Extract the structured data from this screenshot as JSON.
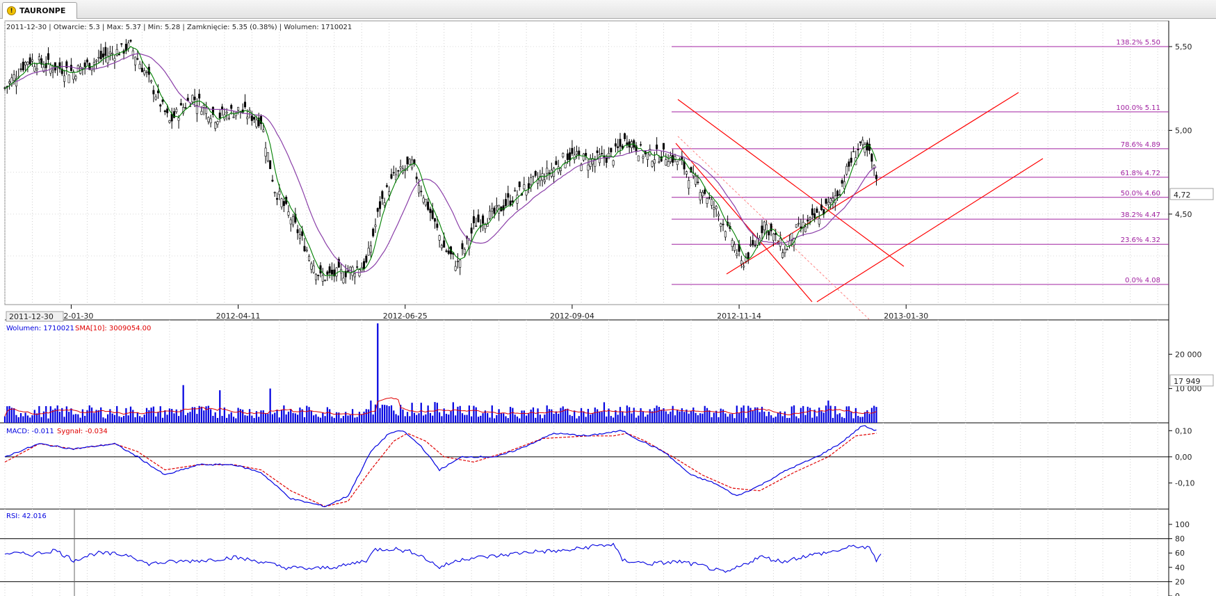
{
  "tab": {
    "title": "TAURONPE",
    "icon": "warning-icon"
  },
  "info": {
    "price": "2011-12-30 | Otwarcie: 5.3 | Max: 5.37 | Min: 5.28 | Zamknięcie: 5.35 (0.38%) | Wolumen: 1710021",
    "volume": "Wolumen: 1710021",
    "volume_sma": "SMA[10]: 3009054.00",
    "macd": "MACD: -0.011",
    "signal": "Sygnał: -0.034",
    "rsi": "RSI: 42.016"
  },
  "cursor": {
    "date": "2011-12-30",
    "price": "4,72",
    "volume": "17 949"
  },
  "colors": {
    "candle": "#000000",
    "sma_fast": "#008000",
    "sma_slow": "#8a3ea8",
    "fib": "#a020a0",
    "trend": "#ff0000",
    "volume": "#0000e0",
    "volume_sma": "#e00000",
    "macd": "#0000e0",
    "signal": "#e00000",
    "rsi": "#0000e0"
  },
  "chart_data": [
    {
      "type": "candlestick",
      "x_ticks": [
        "2012-01-30",
        "2012-04-11",
        "2012-06-25",
        "2012-09-04",
        "2012-11-14",
        "2013-01-30"
      ],
      "y_ticks": [
        "5,50",
        "5,00",
        "4,50"
      ],
      "y_tick_values": [
        5.5,
        5.0,
        4.5
      ],
      "ylim": [
        4.0,
        5.9
      ],
      "close_anchors": [
        [
          0,
          5.25
        ],
        [
          10,
          5.42
        ],
        [
          30,
          5.35
        ],
        [
          45,
          5.45
        ],
        [
          55,
          5.5
        ],
        [
          62,
          5.33
        ],
        [
          72,
          5.05
        ],
        [
          82,
          5.2
        ],
        [
          92,
          5.08
        ],
        [
          102,
          5.12
        ],
        [
          112,
          5.06
        ],
        [
          118,
          4.65
        ],
        [
          128,
          4.4
        ],
        [
          138,
          4.12
        ],
        [
          148,
          4.15
        ],
        [
          158,
          4.2
        ],
        [
          164,
          4.55
        ],
        [
          170,
          4.72
        ],
        [
          178,
          4.8
        ],
        [
          184,
          4.58
        ],
        [
          192,
          4.3
        ],
        [
          198,
          4.2
        ],
        [
          206,
          4.45
        ],
        [
          214,
          4.5
        ],
        [
          222,
          4.6
        ],
        [
          230,
          4.68
        ],
        [
          238,
          4.75
        ],
        [
          246,
          4.85
        ],
        [
          256,
          4.82
        ],
        [
          266,
          4.85
        ],
        [
          272,
          4.95
        ],
        [
          280,
          4.85
        ],
        [
          290,
          4.85
        ],
        [
          296,
          4.8
        ],
        [
          300,
          4.72
        ],
        [
          305,
          4.65
        ],
        [
          312,
          4.5
        ],
        [
          318,
          4.35
        ],
        [
          322,
          4.2
        ],
        [
          328,
          4.32
        ],
        [
          332,
          4.45
        ],
        [
          337,
          4.35
        ],
        [
          341,
          4.28
        ],
        [
          346,
          4.4
        ],
        [
          352,
          4.45
        ],
        [
          360,
          4.55
        ],
        [
          365,
          4.65
        ],
        [
          370,
          4.82
        ],
        [
          374,
          4.92
        ],
        [
          378,
          4.85
        ],
        [
          381,
          4.72
        ]
      ],
      "sma_fast_label": "",
      "sma_slow_label": ""
    },
    {
      "type": "fibonacci",
      "levels": [
        {
          "label": "138.2% 5.50",
          "value": 5.5
        },
        {
          "label": "100.0% 5.11",
          "value": 5.11
        },
        {
          "label": "78.6% 4.89",
          "value": 4.89
        },
        {
          "label": "61.8% 4.72",
          "value": 4.72
        },
        {
          "label": "50.0% 4.60",
          "value": 4.6
        },
        {
          "label": "38.2% 4.47",
          "value": 4.47
        },
        {
          "label": "23.6% 4.32",
          "value": 4.32
        },
        {
          "label": "0.0% 4.08",
          "value": 4.08
        }
      ],
      "start_day": 274,
      "end_day": 415
    },
    {
      "type": "bar",
      "name": "volume",
      "y_ticks": [
        "20 000",
        "10 000"
      ],
      "y_tick_values": [
        20000,
        10000
      ],
      "ylim": [
        0,
        30000
      ],
      "spikes": [
        [
          78,
          11000
        ],
        [
          94,
          9500
        ],
        [
          116,
          10000
        ],
        [
          163,
          29000
        ],
        [
          160,
          6500
        ],
        [
          196,
          6000
        ],
        [
          262,
          6000
        ],
        [
          360,
          6500
        ]
      ],
      "base": 3200
    },
    {
      "type": "line",
      "name": "macd",
      "y_ticks": [
        "0,10",
        "0,00",
        "-0,10"
      ],
      "y_tick_values": [
        0.1,
        0.0,
        -0.1
      ],
      "ylim": [
        -0.2,
        0.13
      ],
      "macd_anchors": [
        [
          0,
          0.0
        ],
        [
          15,
          0.05
        ],
        [
          30,
          0.03
        ],
        [
          48,
          0.05
        ],
        [
          58,
          0.0
        ],
        [
          70,
          -0.07
        ],
        [
          85,
          -0.03
        ],
        [
          100,
          -0.03
        ],
        [
          112,
          -0.06
        ],
        [
          125,
          -0.16
        ],
        [
          140,
          -0.19
        ],
        [
          150,
          -0.15
        ],
        [
          160,
          0.02
        ],
        [
          168,
          0.09
        ],
        [
          174,
          0.1
        ],
        [
          182,
          0.04
        ],
        [
          190,
          -0.05
        ],
        [
          200,
          0.0
        ],
        [
          215,
          0.0
        ],
        [
          225,
          0.03
        ],
        [
          240,
          0.09
        ],
        [
          255,
          0.08
        ],
        [
          262,
          0.09
        ],
        [
          270,
          0.1
        ],
        [
          276,
          0.07
        ],
        [
          288,
          0.02
        ],
        [
          300,
          -0.07
        ],
        [
          310,
          -0.1
        ],
        [
          320,
          -0.15
        ],
        [
          330,
          -0.11
        ],
        [
          342,
          -0.05
        ],
        [
          355,
          0.0
        ],
        [
          365,
          0.05
        ],
        [
          375,
          0.12
        ],
        [
          381,
          0.1
        ]
      ],
      "signal_anchors": [
        [
          0,
          -0.02
        ],
        [
          15,
          0.05
        ],
        [
          30,
          0.03
        ],
        [
          48,
          0.05
        ],
        [
          58,
          0.02
        ],
        [
          70,
          -0.05
        ],
        [
          85,
          -0.03
        ],
        [
          100,
          -0.03
        ],
        [
          112,
          -0.05
        ],
        [
          125,
          -0.13
        ],
        [
          140,
          -0.19
        ],
        [
          150,
          -0.17
        ],
        [
          160,
          -0.05
        ],
        [
          170,
          0.06
        ],
        [
          176,
          0.09
        ],
        [
          184,
          0.06
        ],
        [
          192,
          0.0
        ],
        [
          205,
          -0.02
        ],
        [
          220,
          0.02
        ],
        [
          235,
          0.07
        ],
        [
          255,
          0.08
        ],
        [
          266,
          0.08
        ],
        [
          272,
          0.09
        ],
        [
          280,
          0.06
        ],
        [
          292,
          0.0
        ],
        [
          305,
          -0.07
        ],
        [
          318,
          -0.12
        ],
        [
          330,
          -0.13
        ],
        [
          345,
          -0.06
        ],
        [
          360,
          0.0
        ],
        [
          372,
          0.08
        ],
        [
          381,
          0.09
        ]
      ]
    },
    {
      "type": "line",
      "name": "rsi",
      "y_ticks": [
        "100",
        "80",
        "60",
        "40",
        "20",
        "0"
      ],
      "y_tick_values": [
        100,
        80,
        60,
        40,
        20,
        0
      ],
      "ylim": [
        0,
        100
      ],
      "guide_levels": [
        80,
        20
      ],
      "rsi_anchors": [
        [
          0,
          60
        ],
        [
          12,
          58
        ],
        [
          22,
          64
        ],
        [
          30,
          50
        ],
        [
          40,
          60
        ],
        [
          55,
          57
        ],
        [
          62,
          45
        ],
        [
          75,
          48
        ],
        [
          88,
          50
        ],
        [
          100,
          54
        ],
        [
          112,
          48
        ],
        [
          122,
          40
        ],
        [
          135,
          38
        ],
        [
          148,
          42
        ],
        [
          158,
          50
        ],
        [
          162,
          65
        ],
        [
          170,
          66
        ],
        [
          180,
          60
        ],
        [
          190,
          40
        ],
        [
          200,
          52
        ],
        [
          215,
          56
        ],
        [
          230,
          62
        ],
        [
          245,
          63
        ],
        [
          258,
          70
        ],
        [
          266,
          72
        ],
        [
          270,
          50
        ],
        [
          282,
          45
        ],
        [
          295,
          48
        ],
        [
          305,
          42
        ],
        [
          315,
          32
        ],
        [
          322,
          42
        ],
        [
          330,
          55
        ],
        [
          340,
          48
        ],
        [
          350,
          56
        ],
        [
          362,
          62
        ],
        [
          372,
          70
        ],
        [
          378,
          66
        ],
        [
          381,
          50
        ],
        [
          383,
          60
        ]
      ]
    }
  ]
}
